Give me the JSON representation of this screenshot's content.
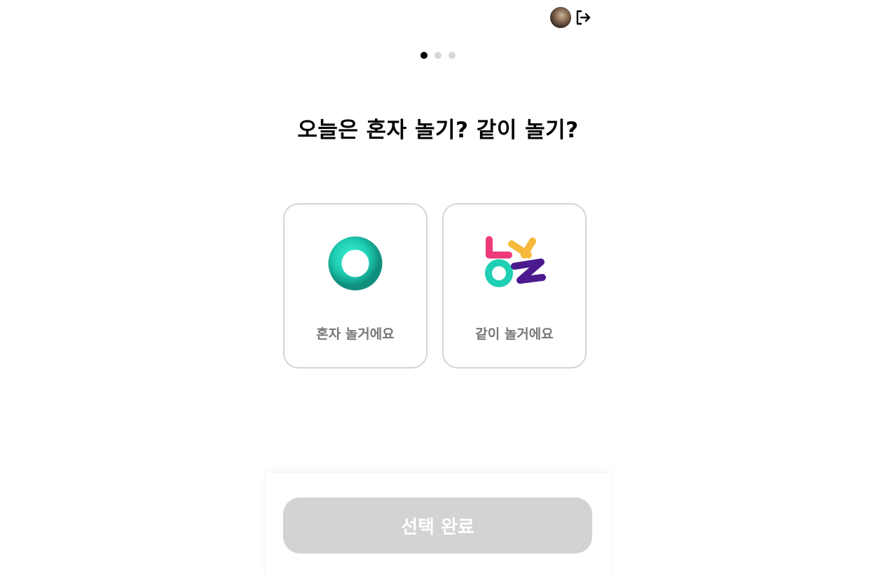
{
  "header": {
    "avatar_icon": "user-avatar",
    "logout_icon": "logout-icon"
  },
  "stepper": {
    "total_steps": 3,
    "current_step": 1
  },
  "question": {
    "title": "오늘은 혼자 놀기? 같이 놀기?"
  },
  "options": [
    {
      "label": "혼자 놀거에요",
      "icon": "teal-ring-icon"
    },
    {
      "label": "같이 놀거에요",
      "icon": "letters-nol-icon"
    }
  ],
  "footer": {
    "submit_label": "선택 완료"
  },
  "colors": {
    "accent_teal": "#1fcfb4",
    "pink": "#ee3a7a",
    "yellow": "#f6b93b",
    "purple": "#4b1a8f",
    "disabled_button": "#d3d3d3",
    "card_border": "#d4d4d4",
    "label_gray": "#777777"
  }
}
